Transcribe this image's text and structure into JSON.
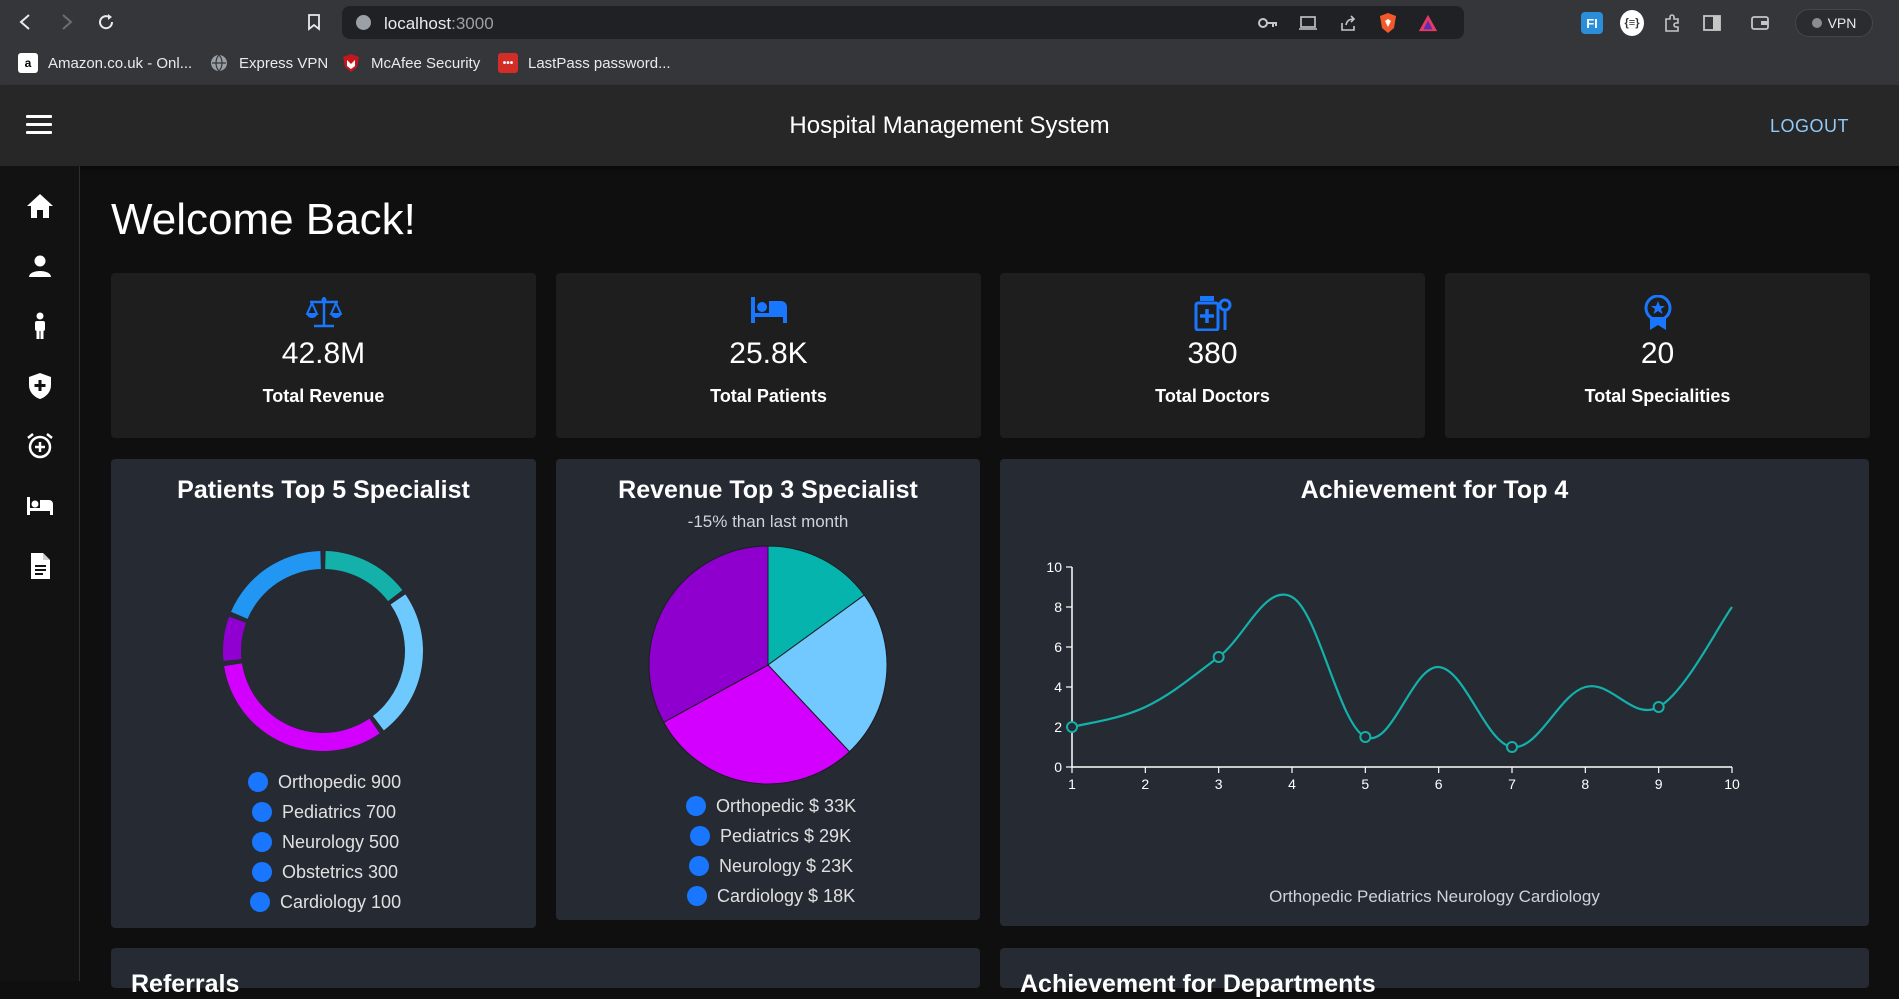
{
  "browser": {
    "url_host": "localhost",
    "url_port": ":3000",
    "vpn_label": "VPN",
    "bookmarks": [
      {
        "label": "Amazon.co.uk - Onl...",
        "fav": "a"
      },
      {
        "label": "Express VPN",
        "fav": ""
      },
      {
        "label": "McAfee Security",
        "fav": ""
      },
      {
        "label": "LastPass password...",
        "fav": "•••"
      }
    ]
  },
  "app": {
    "title": "Hospital Management System",
    "logout_label": "LOGOUT",
    "welcome": "Welcome Back!",
    "accent_color": "#1976ff"
  },
  "sidebar": {
    "icons": [
      "home-icon",
      "person-icon",
      "patient-icon",
      "shield-plus-icon",
      "alarm-add-icon",
      "bed-icon",
      "document-icon"
    ]
  },
  "stats": [
    {
      "icon": "balance-scale-icon",
      "value": "42.8M",
      "label": "Total Revenue"
    },
    {
      "icon": "hotel-bed-icon",
      "value": "25.8K",
      "label": "Total Patients"
    },
    {
      "icon": "medical-kit-icon",
      "value": "380",
      "label": "Total Doctors"
    },
    {
      "icon": "award-badge-icon",
      "value": "20",
      "label": "Total Specialities"
    }
  ],
  "chart_data": [
    {
      "type": "pie",
      "title": "Patients Top 5 Specialist",
      "style": "donut",
      "legend": [
        "Orthopedic 900",
        "Pediatrics 700",
        "Neurology 500",
        "Obstetrics 300",
        "Cardiology 100"
      ],
      "slices": [
        {
          "value": 15,
          "color": "#14b1ab"
        },
        {
          "value": 25,
          "color": "#6ec9ff"
        },
        {
          "value": 33,
          "color": "#d400ff"
        },
        {
          "value": 8,
          "color": "#9000d0"
        },
        {
          "value": 19,
          "color": "#2196f3"
        }
      ]
    },
    {
      "type": "pie",
      "title": "Revenue Top 3 Specialist",
      "subtitle": "-15% than last month",
      "legend": [
        "Orthopedic $ 33K",
        "Pediatrics $ 29K",
        "Neurology $ 23K",
        "Cardiology $ 18K"
      ],
      "slices": [
        {
          "value": 15,
          "color": "#05b5ad"
        },
        {
          "value": 23,
          "color": "#72c9ff"
        },
        {
          "value": 29,
          "color": "#d400ff"
        },
        {
          "value": 33,
          "color": "#8f00cf"
        }
      ]
    },
    {
      "type": "line",
      "title": "Achievement for Top 4",
      "xlabel": "Orthopedic Pediatrics Neurology Cardiology",
      "x": [
        1,
        2,
        3,
        4,
        5,
        6,
        7,
        8,
        9,
        10
      ],
      "y": [
        2,
        3,
        5.5,
        8.5,
        1.5,
        5,
        1,
        4,
        3,
        8
      ],
      "markers_at": [
        1,
        3,
        5,
        7,
        9
      ],
      "xlim": [
        1,
        10
      ],
      "ylim": [
        0,
        10
      ],
      "yticks": [
        0,
        2,
        4,
        6,
        8,
        10
      ],
      "color": "#14b1ab"
    }
  ],
  "bottom": {
    "left_title": "Referrals",
    "right_title": "Achievement for Departments"
  }
}
